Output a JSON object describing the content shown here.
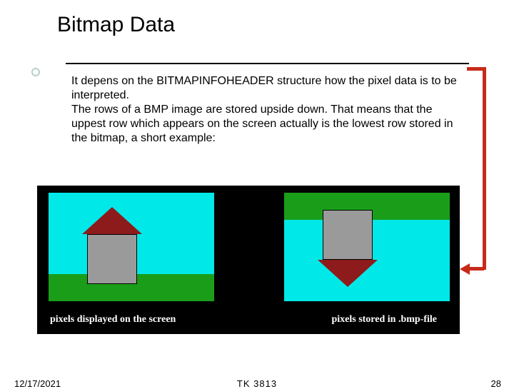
{
  "title": "Bitmap Data",
  "body_p1": "It depens on the BITMAPINFOHEADER structure how the pixel data is to be interpreted.",
  "body_p2": "The rows of a BMP image are stored upside down. That means that the uppest row which appears on the screen actually is the lowest row stored in the bitmap, a short example:",
  "figure": {
    "caption_left": "pixels displayed on the screen",
    "caption_right": "pixels stored in .bmp-file"
  },
  "footer": {
    "date": "12/17/2021",
    "course": "TK 3813",
    "page": "28"
  }
}
